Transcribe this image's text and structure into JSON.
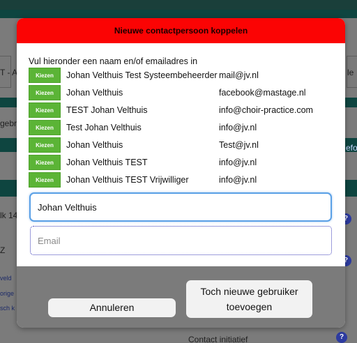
{
  "background": {
    "left_fragments": [
      "T - A.",
      "gebr",
      "lk 14",
      "Z"
    ],
    "left_small_links": [
      "veld",
      "orige",
      "sch k"
    ],
    "right_fragments": [
      "le",
      "efor"
    ],
    "bottom_label": "Contact initiatief",
    "help_icon_glyph": "?"
  },
  "modal": {
    "title": "Nieuwe contactpersoon koppelen",
    "intro": "Vul hieronder een naam en/of emailadres in",
    "rows": [
      {
        "button": "Kiezen",
        "name": "Johan Velthuis Test Systeembeheerder",
        "email": "mail@jv.nl"
      },
      {
        "button": "Kiezen",
        "name": "Johan Velthuis",
        "email": "facebook@mastage.nl"
      },
      {
        "button": "Kiezen",
        "name": "TEST Johan Velthuis",
        "email": "info@choir-practice.com"
      },
      {
        "button": "Kiezen",
        "name": "Test Johan Velthuis",
        "email": "info@jv.nl"
      },
      {
        "button": "Kiezen",
        "name": "Johan Velthuis",
        "email": "Test@jv.nl"
      },
      {
        "button": "Kiezen",
        "name": "Johan Velthuis TEST",
        "email": "info@jv.nl"
      },
      {
        "button": "Kiezen",
        "name": "Johan Velthuis TEST Vrijwilliger",
        "email": "info@jv.nl"
      }
    ],
    "name_input": {
      "value": "Johan Velthuis"
    },
    "email_input": {
      "placeholder": "Email",
      "value": ""
    },
    "cancel_label": "Annuleren",
    "add_label": "Toch nieuwe gebruiker toevoegen"
  },
  "colors": {
    "header_red": "#fb0404",
    "choose_green": "#5bb436",
    "focus_blue": "#5aa0e6"
  }
}
